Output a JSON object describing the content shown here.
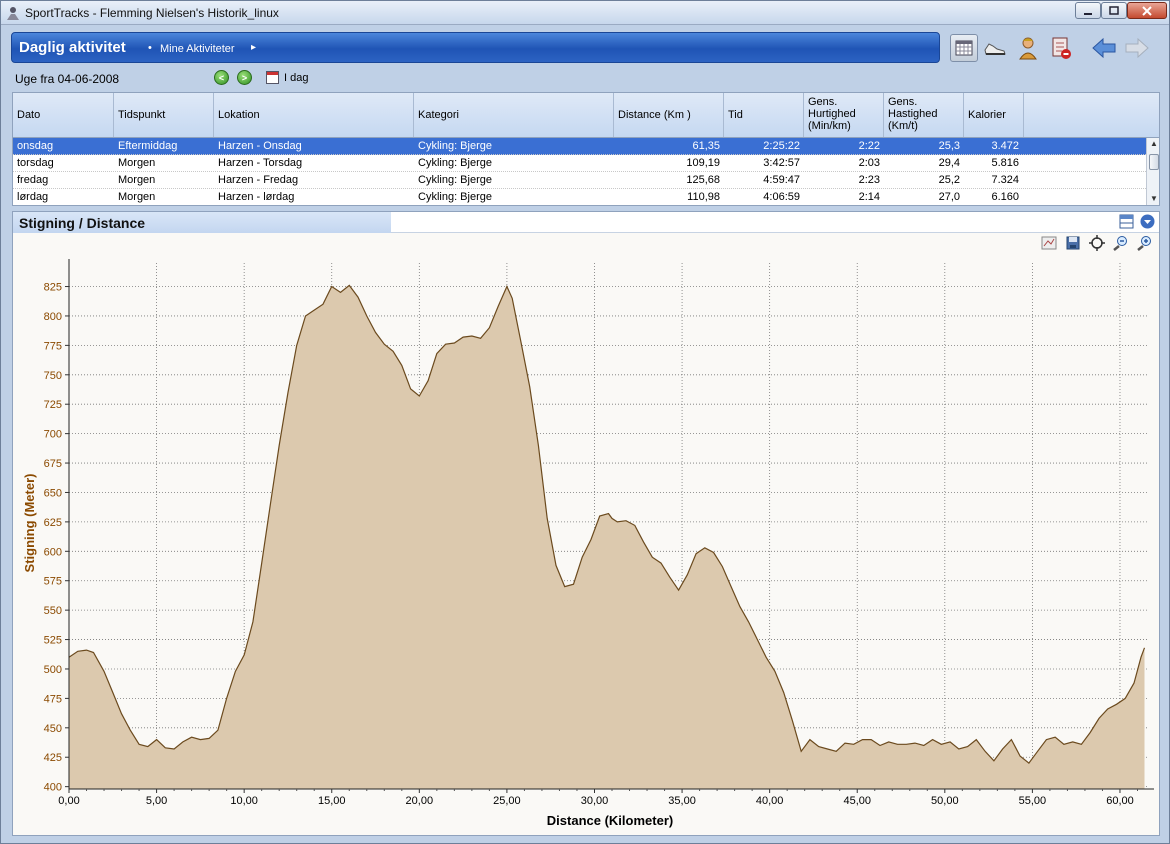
{
  "window": {
    "title": "SportTracks - Flemming Nielsen's Historik_linux"
  },
  "header": {
    "title": "Daglig aktivitet",
    "breadcrumb": "Mine Aktiviteter"
  },
  "toolbar": {
    "icons": [
      "calendar-view-icon",
      "shoe-icon",
      "athlete-icon",
      "delete-icon",
      "back-arrow-icon",
      "forward-arrow-icon"
    ]
  },
  "week": {
    "label": "Uge fra 04-06-2008",
    "today": "I dag"
  },
  "table": {
    "columns": [
      "Dato",
      "Tidspunkt",
      "Lokation",
      "Kategori",
      "Distance (Km )",
      "Tid",
      "Gens. Hurtighed (Min/km)",
      "Gens. Hastighed (Km/t)",
      "Kalorier"
    ],
    "rows": [
      [
        "onsdag",
        "Eftermiddag",
        "Harzen - Onsdag",
        "Cykling: Bjerge",
        "61,35",
        "2:25:22",
        "2:22",
        "25,3",
        "3.472"
      ],
      [
        "torsdag",
        "Morgen",
        "Harzen - Torsdag",
        "Cykling: Bjerge",
        "109,19",
        "3:42:57",
        "2:03",
        "29,4",
        "5.816"
      ],
      [
        "fredag",
        "Morgen",
        "Harzen - Fredag",
        "Cykling: Bjerge",
        "125,68",
        "4:59:47",
        "2:23",
        "25,2",
        "7.324"
      ],
      [
        "lørdag",
        "Morgen",
        "Harzen - lørdag",
        "Cykling: Bjerge",
        "110,98",
        "4:06:59",
        "2:14",
        "27,0",
        "6.160"
      ]
    ],
    "selected_row": 0
  },
  "chart_panel": {
    "title": "Stigning / Distance"
  },
  "colors": {
    "fill": "#dcc9ae",
    "stroke": "#6b4a1e",
    "axis_label": "#8b4a00"
  },
  "chart_data": {
    "type": "area",
    "xlabel": "Distance (Kilometer)",
    "ylabel": "Stigning (Meter)",
    "xlim": [
      0,
      61.6
    ],
    "ylim": [
      398,
      845
    ],
    "xticks": [
      "0,00",
      "5,00",
      "10,00",
      "15,00",
      "20,00",
      "25,00",
      "30,00",
      "35,00",
      "40,00",
      "45,00",
      "50,00",
      "55,00",
      "60,00"
    ],
    "yticks": [
      "400",
      "425",
      "450",
      "475",
      "500",
      "525",
      "550",
      "575",
      "600",
      "625",
      "650",
      "675",
      "700",
      "725",
      "750",
      "775",
      "800",
      "825"
    ],
    "grid": true,
    "x": [
      0,
      0.5,
      1,
      1.4,
      2,
      2.5,
      3,
      3.5,
      4,
      4.5,
      5,
      5.5,
      6,
      6.5,
      7,
      7.5,
      8,
      8.5,
      9,
      9.5,
      10,
      10.5,
      11,
      11.5,
      12,
      12.5,
      13,
      13.5,
      14,
      14.5,
      15,
      15.5,
      16,
      16.5,
      17,
      17.5,
      18,
      18.5,
      19,
      19.5,
      20,
      20.5,
      21,
      21.5,
      22,
      22.5,
      23,
      23.5,
      24,
      24.5,
      25,
      25.3,
      25.8,
      26.3,
      26.8,
      27.3,
      27.8,
      28.3,
      28.8,
      29.3,
      29.8,
      30.3,
      30.8,
      31,
      31.3,
      31.8,
      32.3,
      32.8,
      33.3,
      33.8,
      34.3,
      34.8,
      35.3,
      35.8,
      36.3,
      36.8,
      37.3,
      37.8,
      38.3,
      38.8,
      39.3,
      39.8,
      40.3,
      40.8,
      41.3,
      41.8,
      42.3,
      42.8,
      43.3,
      43.8,
      44.3,
      44.8,
      45.3,
      45.8,
      46.3,
      46.8,
      47.3,
      47.8,
      48.3,
      48.8,
      49.3,
      49.8,
      50.3,
      50.8,
      51.3,
      51.8,
      52.3,
      52.8,
      53.3,
      53.8,
      54.3,
      54.8,
      55.3,
      55.8,
      56.3,
      56.8,
      57.3,
      57.8,
      58.3,
      58.8,
      59.3,
      59.8,
      60.3,
      60.8,
      61.2,
      61.4
    ],
    "y": [
      510,
      515,
      516,
      514,
      498,
      480,
      462,
      448,
      436,
      434,
      440,
      433,
      432,
      438,
      442,
      440,
      441,
      448,
      475,
      498,
      512,
      540,
      590,
      640,
      690,
      735,
      775,
      800,
      805,
      810,
      825,
      820,
      826,
      816,
      800,
      786,
      776,
      770,
      758,
      738,
      732,
      745,
      768,
      776,
      777,
      782,
      783,
      781,
      790,
      808,
      825,
      815,
      778,
      740,
      690,
      628,
      588,
      570,
      572,
      595,
      610,
      630,
      632,
      628,
      625,
      626,
      622,
      608,
      595,
      590,
      578,
      567,
      580,
      598,
      603,
      599,
      587,
      570,
      553,
      540,
      525,
      510,
      498,
      480,
      456,
      430,
      440,
      434,
      432,
      430,
      437,
      436,
      440,
      440,
      435,
      438,
      436,
      436,
      437,
      435,
      440,
      436,
      438,
      432,
      434,
      440,
      430,
      422,
      432,
      440,
      426,
      420,
      430,
      440,
      442,
      436,
      438,
      436,
      446,
      458,
      466,
      470,
      475,
      488,
      510,
      518,
      515,
      514
    ]
  }
}
